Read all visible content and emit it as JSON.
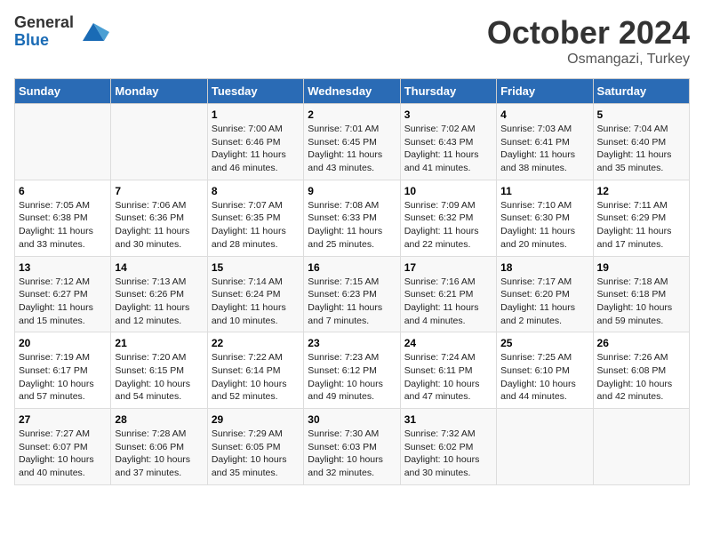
{
  "header": {
    "logo_general": "General",
    "logo_blue": "Blue",
    "month_title": "October 2024",
    "location": "Osmangazi, Turkey"
  },
  "days_of_week": [
    "Sunday",
    "Monday",
    "Tuesday",
    "Wednesday",
    "Thursday",
    "Friday",
    "Saturday"
  ],
  "weeks": [
    [
      {
        "day": "",
        "sunrise": "",
        "sunset": "",
        "daylight": ""
      },
      {
        "day": "",
        "sunrise": "",
        "sunset": "",
        "daylight": ""
      },
      {
        "day": "1",
        "sunrise": "Sunrise: 7:00 AM",
        "sunset": "Sunset: 6:46 PM",
        "daylight": "Daylight: 11 hours and 46 minutes."
      },
      {
        "day": "2",
        "sunrise": "Sunrise: 7:01 AM",
        "sunset": "Sunset: 6:45 PM",
        "daylight": "Daylight: 11 hours and 43 minutes."
      },
      {
        "day": "3",
        "sunrise": "Sunrise: 7:02 AM",
        "sunset": "Sunset: 6:43 PM",
        "daylight": "Daylight: 11 hours and 41 minutes."
      },
      {
        "day": "4",
        "sunrise": "Sunrise: 7:03 AM",
        "sunset": "Sunset: 6:41 PM",
        "daylight": "Daylight: 11 hours and 38 minutes."
      },
      {
        "day": "5",
        "sunrise": "Sunrise: 7:04 AM",
        "sunset": "Sunset: 6:40 PM",
        "daylight": "Daylight: 11 hours and 35 minutes."
      }
    ],
    [
      {
        "day": "6",
        "sunrise": "Sunrise: 7:05 AM",
        "sunset": "Sunset: 6:38 PM",
        "daylight": "Daylight: 11 hours and 33 minutes."
      },
      {
        "day": "7",
        "sunrise": "Sunrise: 7:06 AM",
        "sunset": "Sunset: 6:36 PM",
        "daylight": "Daylight: 11 hours and 30 minutes."
      },
      {
        "day": "8",
        "sunrise": "Sunrise: 7:07 AM",
        "sunset": "Sunset: 6:35 PM",
        "daylight": "Daylight: 11 hours and 28 minutes."
      },
      {
        "day": "9",
        "sunrise": "Sunrise: 7:08 AM",
        "sunset": "Sunset: 6:33 PM",
        "daylight": "Daylight: 11 hours and 25 minutes."
      },
      {
        "day": "10",
        "sunrise": "Sunrise: 7:09 AM",
        "sunset": "Sunset: 6:32 PM",
        "daylight": "Daylight: 11 hours and 22 minutes."
      },
      {
        "day": "11",
        "sunrise": "Sunrise: 7:10 AM",
        "sunset": "Sunset: 6:30 PM",
        "daylight": "Daylight: 11 hours and 20 minutes."
      },
      {
        "day": "12",
        "sunrise": "Sunrise: 7:11 AM",
        "sunset": "Sunset: 6:29 PM",
        "daylight": "Daylight: 11 hours and 17 minutes."
      }
    ],
    [
      {
        "day": "13",
        "sunrise": "Sunrise: 7:12 AM",
        "sunset": "Sunset: 6:27 PM",
        "daylight": "Daylight: 11 hours and 15 minutes."
      },
      {
        "day": "14",
        "sunrise": "Sunrise: 7:13 AM",
        "sunset": "Sunset: 6:26 PM",
        "daylight": "Daylight: 11 hours and 12 minutes."
      },
      {
        "day": "15",
        "sunrise": "Sunrise: 7:14 AM",
        "sunset": "Sunset: 6:24 PM",
        "daylight": "Daylight: 11 hours and 10 minutes."
      },
      {
        "day": "16",
        "sunrise": "Sunrise: 7:15 AM",
        "sunset": "Sunset: 6:23 PM",
        "daylight": "Daylight: 11 hours and 7 minutes."
      },
      {
        "day": "17",
        "sunrise": "Sunrise: 7:16 AM",
        "sunset": "Sunset: 6:21 PM",
        "daylight": "Daylight: 11 hours and 4 minutes."
      },
      {
        "day": "18",
        "sunrise": "Sunrise: 7:17 AM",
        "sunset": "Sunset: 6:20 PM",
        "daylight": "Daylight: 11 hours and 2 minutes."
      },
      {
        "day": "19",
        "sunrise": "Sunrise: 7:18 AM",
        "sunset": "Sunset: 6:18 PM",
        "daylight": "Daylight: 10 hours and 59 minutes."
      }
    ],
    [
      {
        "day": "20",
        "sunrise": "Sunrise: 7:19 AM",
        "sunset": "Sunset: 6:17 PM",
        "daylight": "Daylight: 10 hours and 57 minutes."
      },
      {
        "day": "21",
        "sunrise": "Sunrise: 7:20 AM",
        "sunset": "Sunset: 6:15 PM",
        "daylight": "Daylight: 10 hours and 54 minutes."
      },
      {
        "day": "22",
        "sunrise": "Sunrise: 7:22 AM",
        "sunset": "Sunset: 6:14 PM",
        "daylight": "Daylight: 10 hours and 52 minutes."
      },
      {
        "day": "23",
        "sunrise": "Sunrise: 7:23 AM",
        "sunset": "Sunset: 6:12 PM",
        "daylight": "Daylight: 10 hours and 49 minutes."
      },
      {
        "day": "24",
        "sunrise": "Sunrise: 7:24 AM",
        "sunset": "Sunset: 6:11 PM",
        "daylight": "Daylight: 10 hours and 47 minutes."
      },
      {
        "day": "25",
        "sunrise": "Sunrise: 7:25 AM",
        "sunset": "Sunset: 6:10 PM",
        "daylight": "Daylight: 10 hours and 44 minutes."
      },
      {
        "day": "26",
        "sunrise": "Sunrise: 7:26 AM",
        "sunset": "Sunset: 6:08 PM",
        "daylight": "Daylight: 10 hours and 42 minutes."
      }
    ],
    [
      {
        "day": "27",
        "sunrise": "Sunrise: 7:27 AM",
        "sunset": "Sunset: 6:07 PM",
        "daylight": "Daylight: 10 hours and 40 minutes."
      },
      {
        "day": "28",
        "sunrise": "Sunrise: 7:28 AM",
        "sunset": "Sunset: 6:06 PM",
        "daylight": "Daylight: 10 hours and 37 minutes."
      },
      {
        "day": "29",
        "sunrise": "Sunrise: 7:29 AM",
        "sunset": "Sunset: 6:05 PM",
        "daylight": "Daylight: 10 hours and 35 minutes."
      },
      {
        "day": "30",
        "sunrise": "Sunrise: 7:30 AM",
        "sunset": "Sunset: 6:03 PM",
        "daylight": "Daylight: 10 hours and 32 minutes."
      },
      {
        "day": "31",
        "sunrise": "Sunrise: 7:32 AM",
        "sunset": "Sunset: 6:02 PM",
        "daylight": "Daylight: 10 hours and 30 minutes."
      },
      {
        "day": "",
        "sunrise": "",
        "sunset": "",
        "daylight": ""
      },
      {
        "day": "",
        "sunrise": "",
        "sunset": "",
        "daylight": ""
      }
    ]
  ]
}
